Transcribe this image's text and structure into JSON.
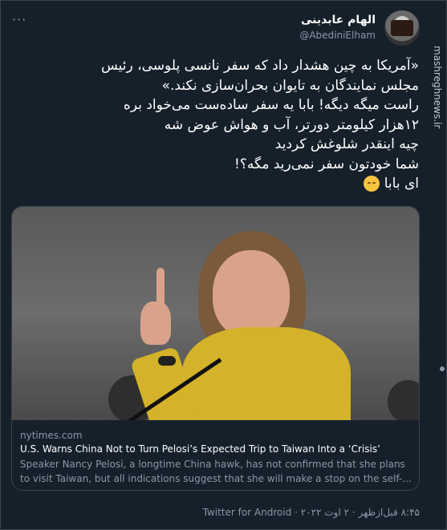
{
  "author": {
    "name": "الهام عابدینی",
    "handle": "@AbediniElham",
    "avatar_icon": "profile-photo"
  },
  "watermark": "mashreghnews.ir",
  "tweet": {
    "lines": [
      "«آمریکا به چین هشدار داد که سفر نانسی پلوسی، رئیس",
      "مجلس نمایندگان به تایوان بحران‌سازی نکند.»",
      "راست میگه دیگه! بابا یه سفر ساده‌ست می‌خواد بره",
      "۱۲هزار کیلومتر دورتر، آب و هواش عوض شه",
      "چیه اینقدر شلوغش کردید",
      "شما خودتون سفر نمی‌رید مگه؟!",
      "ای بابا"
    ],
    "emoji": "relieved-face"
  },
  "card": {
    "domain": "nytimes.com",
    "title": "U.S. Warns China Not to Turn Pelosi’s Expected Trip to Taiwan Into a ‘Crisis’",
    "description": "Speaker Nancy Pelosi, a longtime China hawk, has not confirmed that she plans to visit Taiwan, but all indications suggest that she will make a stop on the self-..."
  },
  "footer": "۸:۴۵ قبل‌ازظهر · ۲ اوت ۲۰۲۲ · Twitter for Android",
  "colors": {
    "background": "#15202b",
    "secondary_text": "#8899a6",
    "border": "#38444d"
  }
}
